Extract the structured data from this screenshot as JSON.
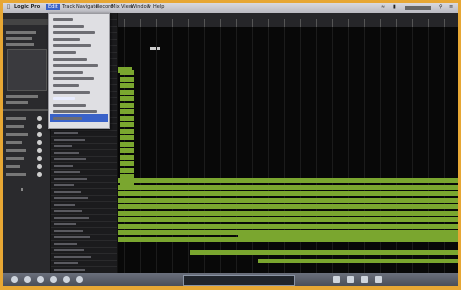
{
  "menubar": {
    "items": [
      "Logic Pro",
      "Edit",
      "Track",
      "Navigate",
      "Record",
      "Mix",
      "View",
      "Window",
      "?",
      "Help"
    ],
    "active_index": 1,
    "status_icons": [
      "wifi-icon",
      "battery-icon",
      "clock-text",
      "search-icon",
      "menu-icon"
    ]
  },
  "inspector": {
    "title": "Region: Audio"
  },
  "dropdown": {
    "item_count": 16,
    "highlighted_index": 12
  },
  "colors": {
    "region": "#7aa62f",
    "menu_highlight": "#3a62c9",
    "frame": "#e7a734"
  }
}
